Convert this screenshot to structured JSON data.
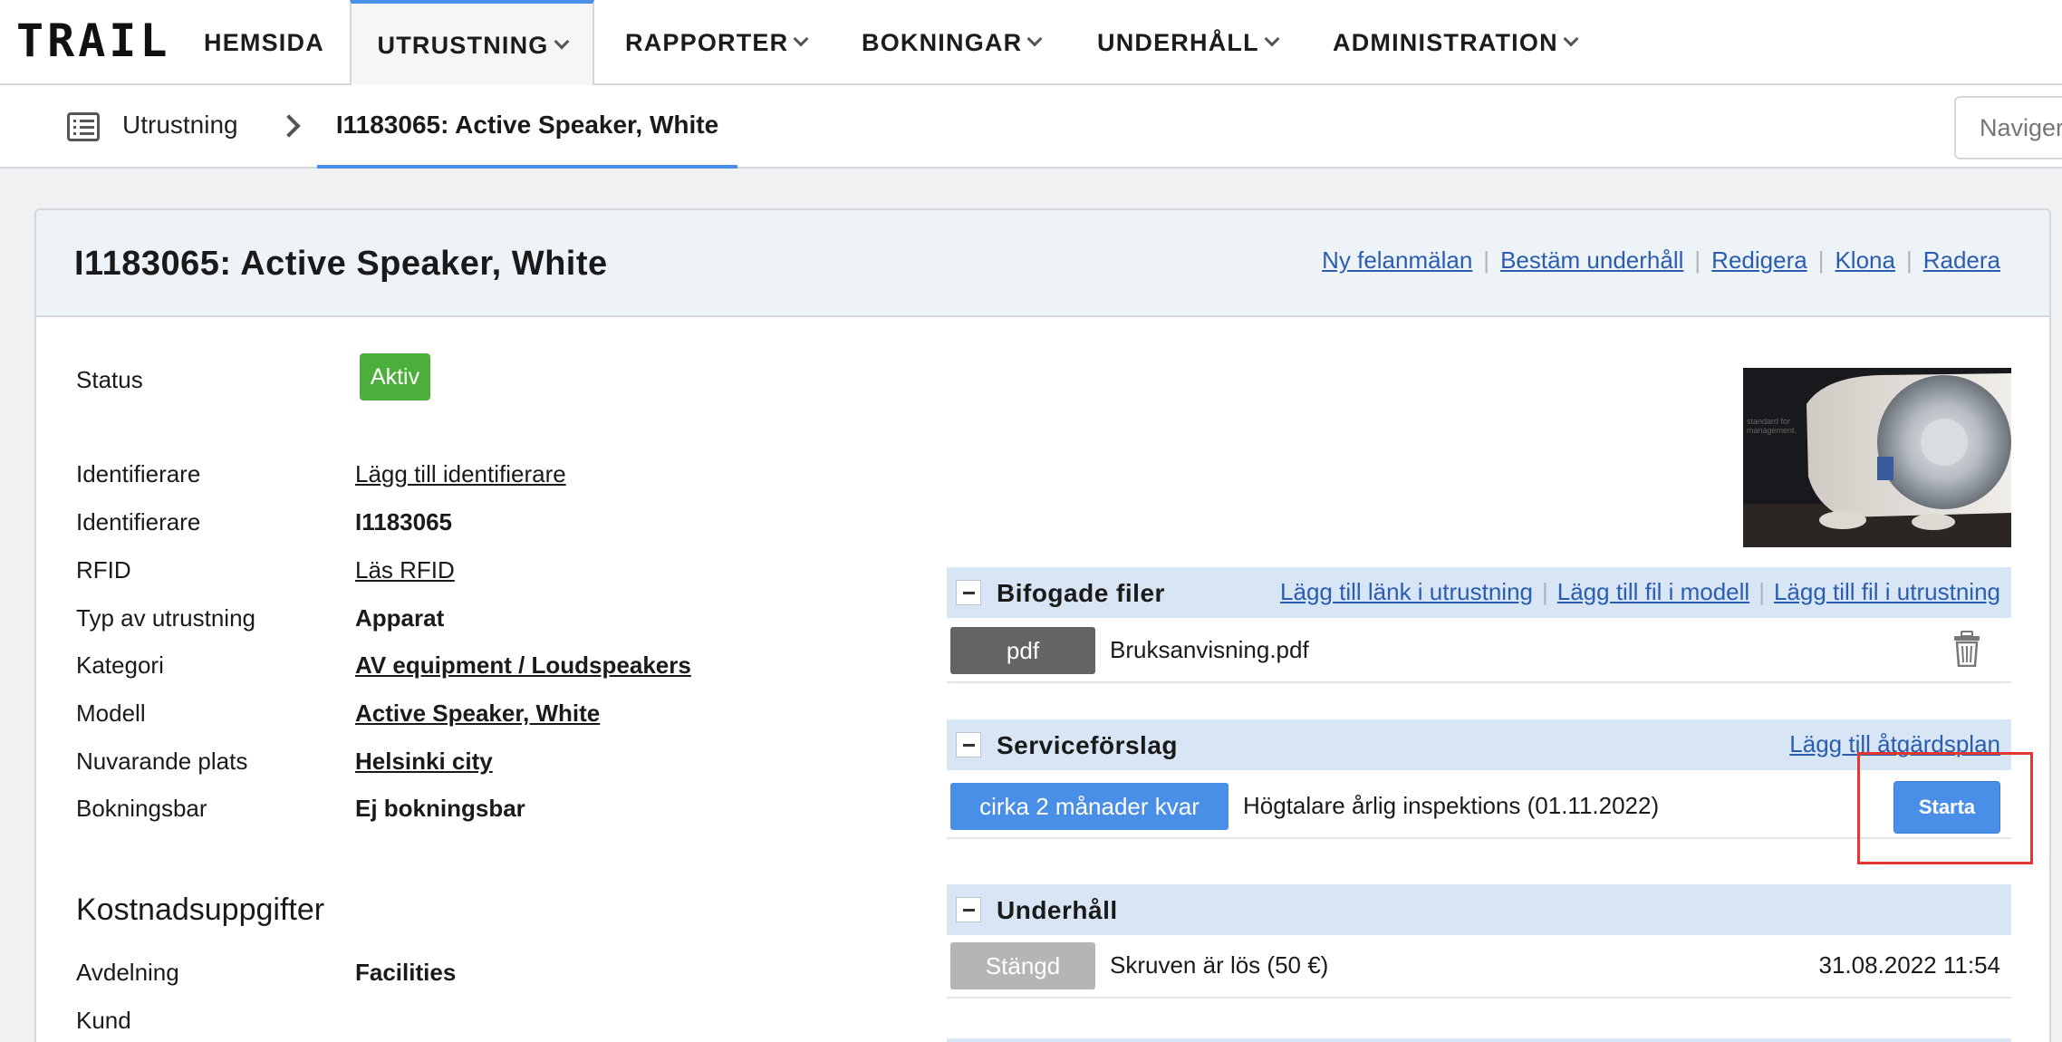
{
  "logo": "TRAIL",
  "nav": {
    "items": [
      {
        "label": "HEMSIDA"
      },
      {
        "label": "UTRUSTNING"
      },
      {
        "label": "RAPPORTER"
      },
      {
        "label": "BOKNINGAR"
      },
      {
        "label": "UNDERHÅLL"
      },
      {
        "label": "ADMINISTRATION"
      }
    ],
    "active": "UTRUSTNING"
  },
  "breadcrumb": {
    "root": "Utrustning",
    "current": "I1183065: Active Speaker, White"
  },
  "navigator": {
    "placeholder": "Navigera"
  },
  "panel": {
    "title": "I1183065: Active Speaker, White",
    "actions": [
      "Ny felanmälan",
      "Bestäm underhåll",
      "Redigera",
      "Klona",
      "Radera"
    ]
  },
  "details": {
    "status_label": "Status",
    "status_value": "Aktiv",
    "rows": [
      {
        "label": "Identifierare",
        "value": "Lägg till identifierare"
      },
      {
        "label": "Identifierare",
        "value": "I1183065"
      },
      {
        "label": "RFID",
        "value": "Läs RFID"
      },
      {
        "label": "Typ av utrustning",
        "value": "Apparat"
      },
      {
        "label": "Kategori",
        "value": "AV equipment / Loudspeakers"
      },
      {
        "label": "Modell",
        "value": "Active Speaker, White"
      },
      {
        "label": "Nuvarande plats",
        "value": "Helsinki city"
      },
      {
        "label": "Bokningsbar",
        "value": "Ej bokningsbar"
      }
    ]
  },
  "costs": {
    "title": "Kostnadsuppgifter",
    "rows": [
      {
        "label": "Avdelning",
        "value": "Facilities"
      },
      {
        "label": "Kund",
        "value": ""
      }
    ]
  },
  "image_text": [
    "standard for",
    "management."
  ],
  "attachments": {
    "title": "Bifogade filer",
    "links": [
      "Lägg till länk i utrustning",
      "Lägg till fil i modell",
      "Lägg till fil i utrustning"
    ],
    "files": [
      {
        "type": "pdf",
        "name": "Bruksanvisning.pdf"
      }
    ]
  },
  "service": {
    "title": "Serviceförslag",
    "link": "Lägg till åtgärdsplan",
    "items": [
      {
        "badge": "cirka 2 månader kvar",
        "text": "Högtalare årlig inspektions (01.11.2022)",
        "button": "Starta"
      }
    ]
  },
  "maintenance": {
    "title": "Underhåll",
    "items": [
      {
        "badge": "Stängd",
        "text": "Skruven är lös (50 €)",
        "date": "31.08.2022 11:54"
      }
    ]
  },
  "colors": {
    "accent": "#4a8fe7",
    "status_active": "#4caf3c",
    "status_closed": "#b5b5b5",
    "file_badge": "#646464",
    "highlight": "#e1382f",
    "section_header": "#d7e5f5"
  }
}
